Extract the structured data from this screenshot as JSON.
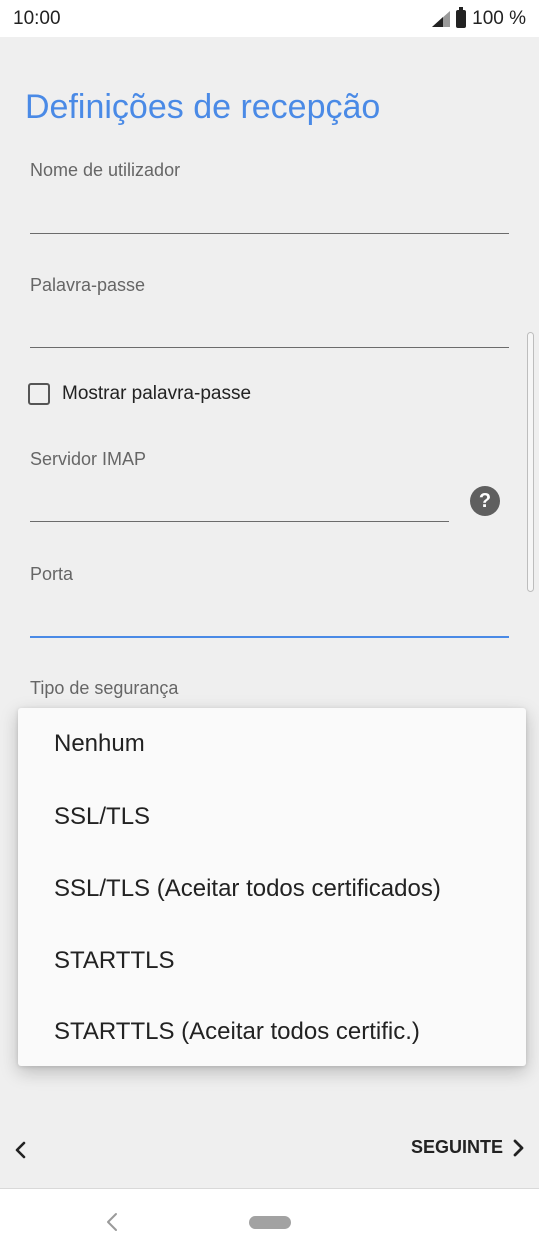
{
  "status_bar": {
    "time": "10:00",
    "battery": "100 %",
    "signal_icon": "signal-icon",
    "battery_icon": "battery-icon"
  },
  "form": {
    "title": "Definições de recepção",
    "username_label": "Nome de utilizador",
    "username_value": "",
    "password_label": "Palavra-passe",
    "password_value": "",
    "show_password_label": "Mostrar palavra-passe",
    "show_password_checked": false,
    "imap_server_label": "Servidor IMAP",
    "imap_server_value": "",
    "help_icon": "?",
    "port_label": "Porta",
    "port_value": "",
    "security_type_label": "Tipo de segurança"
  },
  "security_dropdown": {
    "options": [
      "Nenhum",
      "SSL/TLS",
      "SSL/TLS (Aceitar todos certificados)",
      "STARTTLS",
      "STARTTLS (Aceitar todos certific.)"
    ]
  },
  "bottom_bar": {
    "back_icon": "chevron-left-icon",
    "next_label": "SEGUINTE",
    "next_icon": "chevron-right-icon"
  },
  "nav_bar": {
    "back_icon": "nav-back-icon",
    "home_icon": "nav-home-pill"
  },
  "colors": {
    "accent": "#4a8ae6",
    "background": "#efefef"
  }
}
